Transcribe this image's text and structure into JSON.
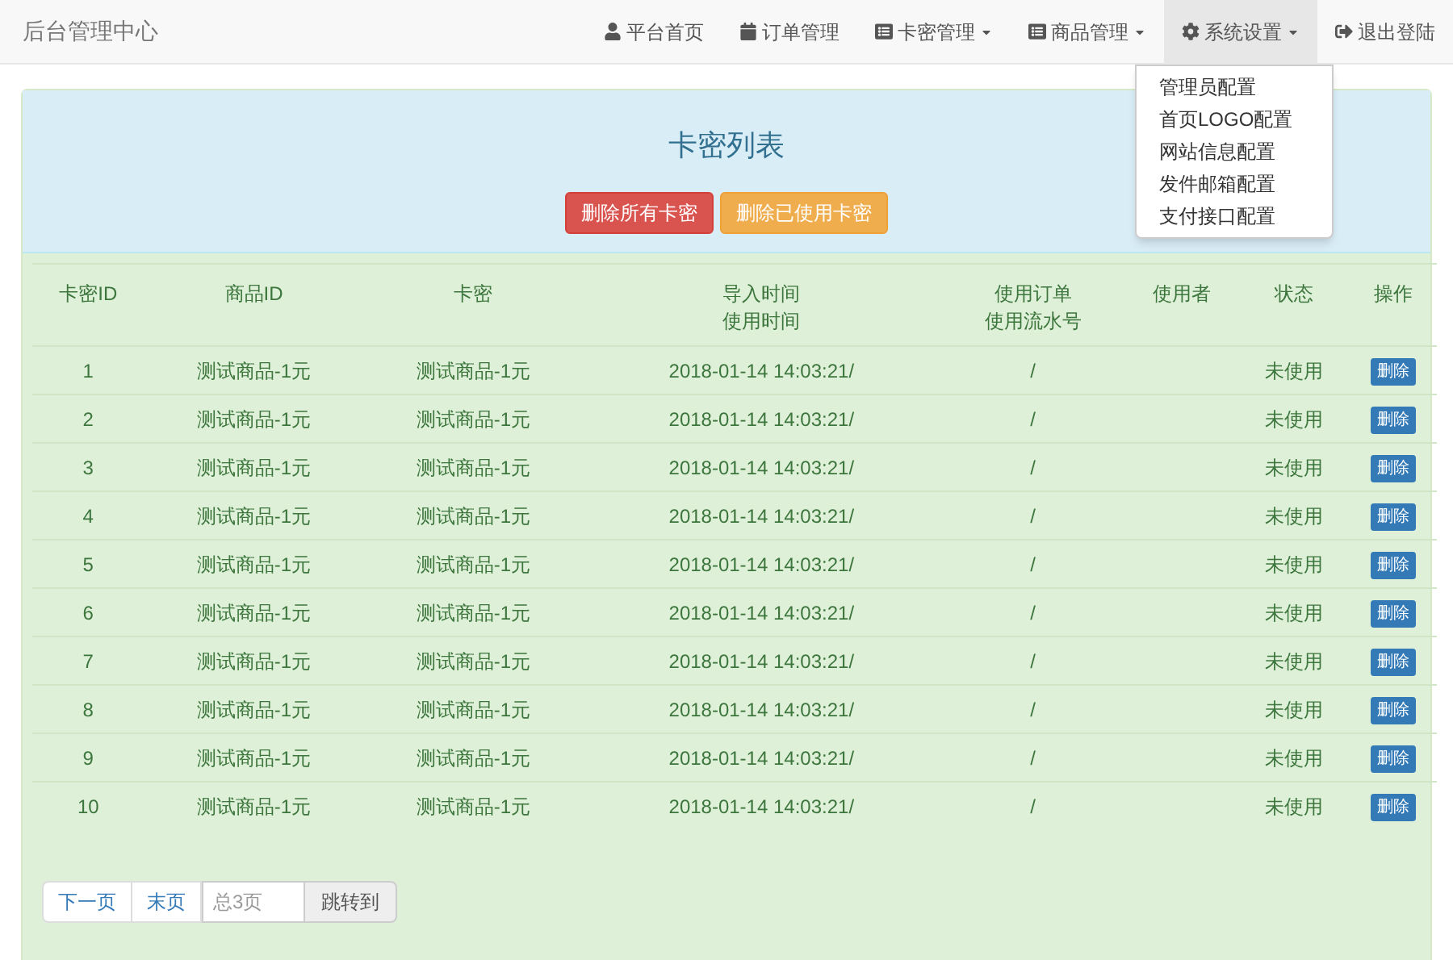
{
  "brand": "后台管理中心",
  "nav": [
    {
      "label": "平台首页",
      "dropdown": false,
      "selected": false
    },
    {
      "label": "订单管理",
      "dropdown": false,
      "selected": false
    },
    {
      "label": "卡密管理",
      "dropdown": true,
      "selected": false
    },
    {
      "label": "商品管理",
      "dropdown": true,
      "selected": false
    },
    {
      "label": "系统设置",
      "dropdown": true,
      "selected": true
    },
    {
      "label": "退出登陆",
      "dropdown": false,
      "selected": false
    }
  ],
  "dropdown_menu": [
    "管理员配置",
    "首页LOGO配置",
    "网站信息配置",
    "发件邮箱配置",
    "支付接口配置"
  ],
  "panel": {
    "title": "卡密列表",
    "buttons": [
      {
        "label": "删除所有卡密",
        "kind": "danger"
      },
      {
        "label": "删除已使用卡密",
        "kind": "warning"
      }
    ]
  },
  "table": {
    "columns": [
      [
        "卡密ID"
      ],
      [
        "商品ID"
      ],
      [
        "卡密"
      ],
      [
        "导入时间",
        "使用时间"
      ],
      [
        "使用订单",
        "使用流水号"
      ],
      [
        "使用者"
      ],
      [
        "状态"
      ],
      [
        "操作"
      ]
    ],
    "rows": [
      {
        "id": "1",
        "product": "测试商品-1元",
        "card": "测试商品-1元",
        "time": "2018-01-14 14:03:21/",
        "order": "/",
        "user": "",
        "status": "未使用",
        "action": "删除"
      },
      {
        "id": "2",
        "product": "测试商品-1元",
        "card": "测试商品-1元",
        "time": "2018-01-14 14:03:21/",
        "order": "/",
        "user": "",
        "status": "未使用",
        "action": "删除"
      },
      {
        "id": "3",
        "product": "测试商品-1元",
        "card": "测试商品-1元",
        "time": "2018-01-14 14:03:21/",
        "order": "/",
        "user": "",
        "status": "未使用",
        "action": "删除"
      },
      {
        "id": "4",
        "product": "测试商品-1元",
        "card": "测试商品-1元",
        "time": "2018-01-14 14:03:21/",
        "order": "/",
        "user": "",
        "status": "未使用",
        "action": "删除"
      },
      {
        "id": "5",
        "product": "测试商品-1元",
        "card": "测试商品-1元",
        "time": "2018-01-14 14:03:21/",
        "order": "/",
        "user": "",
        "status": "未使用",
        "action": "删除"
      },
      {
        "id": "6",
        "product": "测试商品-1元",
        "card": "测试商品-1元",
        "time": "2018-01-14 14:03:21/",
        "order": "/",
        "user": "",
        "status": "未使用",
        "action": "删除"
      },
      {
        "id": "7",
        "product": "测试商品-1元",
        "card": "测试商品-1元",
        "time": "2018-01-14 14:03:21/",
        "order": "/",
        "user": "",
        "status": "未使用",
        "action": "删除"
      },
      {
        "id": "8",
        "product": "测试商品-1元",
        "card": "测试商品-1元",
        "time": "2018-01-14 14:03:21/",
        "order": "/",
        "user": "",
        "status": "未使用",
        "action": "删除"
      },
      {
        "id": "9",
        "product": "测试商品-1元",
        "card": "测试商品-1元",
        "time": "2018-01-14 14:03:21/",
        "order": "/",
        "user": "",
        "status": "未使用",
        "action": "删除"
      },
      {
        "id": "10",
        "product": "测试商品-1元",
        "card": "测试商品-1元",
        "time": "2018-01-14 14:03:21/",
        "order": "/",
        "user": "",
        "status": "未使用",
        "action": "删除"
      }
    ]
  },
  "pagination": {
    "links": [
      "下一页",
      "末页"
    ],
    "jump_field": {
      "placeholder": "总3页"
    },
    "jump_button": "跳转到"
  }
}
